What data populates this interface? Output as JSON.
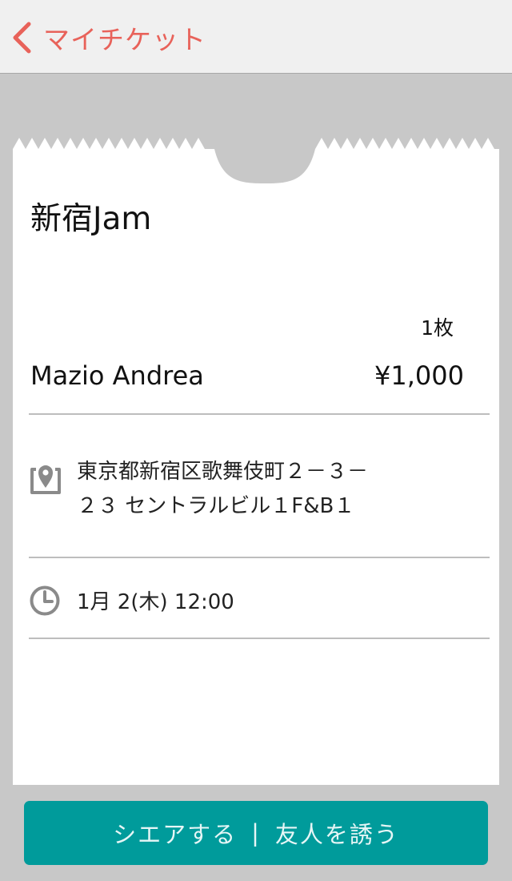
{
  "nav": {
    "back_label": "マイチケット",
    "accent": "#e8625a"
  },
  "ticket": {
    "venue": "新宿Jam",
    "quantity": "1枚",
    "holder_name": "Mazio Andrea",
    "price": "¥1,000",
    "address_line1": "東京都新宿区歌舞伎町２－３－",
    "address_line2": "２３ セントラルビル１F&B１",
    "datetime": "1月 2(木) 12:00"
  },
  "actions": {
    "share_label": "シエアする",
    "separator": "|",
    "invite_label": "友人を誘う",
    "button_color": "#009b9b"
  },
  "icons": {
    "back": "chevron-left-icon",
    "location": "map-pin-icon",
    "time": "clock-icon"
  }
}
